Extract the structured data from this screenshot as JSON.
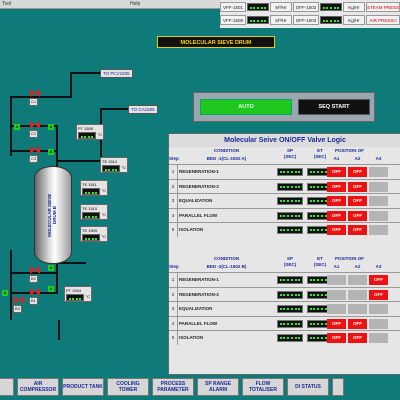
{
  "topbar": {
    "left_label": "Tool",
    "right_label": "Help"
  },
  "header": {
    "rows": [
      {
        "tag1": "VFF-1501",
        "unit1": "M³/Hr",
        "tag2": "OFF-1502",
        "unit2": "Kg/Hr",
        "status": "STEAM PRESS"
      },
      {
        "tag1": "VFF-1505",
        "unit1": "M³/Hr",
        "tag2": "OFF-1503",
        "unit2": "Kg/Hr",
        "status": "AIR PRESSU"
      }
    ]
  },
  "drum_title": "MOLECULAR SIEVE DRUM",
  "vessel": {
    "label": "MOLECULAR SIEVE DRUM B",
    "tag": "CL-1502B"
  },
  "destinations": {
    "d1": "TO PCV1505",
    "d2": "TO CA1506"
  },
  "instruments": [
    {
      "tag": "PT 1505",
      "unit": "°C"
    },
    {
      "tag": "TE 1514",
      "unit": "°C"
    },
    {
      "tag": "TE 1511",
      "unit": "°C"
    },
    {
      "tag": "TE 1510",
      "unit": "°C"
    },
    {
      "tag": "TE 1509",
      "unit": "°C"
    },
    {
      "tag": "PT 1504",
      "unit": "°C"
    }
  ],
  "valves": {
    "c1": "C1",
    "c2": "C2",
    "c3": "C3",
    "b1": "B1",
    "b2": "B2",
    "b3": "B3"
  },
  "controls": {
    "auto": "AUTO",
    "seq_start": "SEQ START"
  },
  "table": {
    "title": "Molecular Seive ON/OFF Valve Logic",
    "h_step": "Step",
    "h_condition": "CONDITION",
    "h_sp": "SP",
    "h_sp_unit": "(SEC)",
    "h_et": "ET",
    "h_et_unit": "(SEC)",
    "h_position": "POSITION OF",
    "pos_cols": [
      "A1",
      "A2",
      "A3"
    ],
    "bed1": {
      "name": "BED -1(CL-1502 A)",
      "rows": [
        {
          "step": "1",
          "cond": "REGENERATION-1",
          "pos": [
            "OFF",
            "OFF",
            ""
          ]
        },
        {
          "step": "2",
          "cond": "REGENERATION-2",
          "pos": [
            "OFF",
            "OFF",
            ""
          ]
        },
        {
          "step": "3",
          "cond": "EQUALIZATION",
          "pos": [
            "OFF",
            "OFF",
            ""
          ]
        },
        {
          "step": "4",
          "cond": "PARALLEL FLOW",
          "pos": [
            "OFF",
            "OFF",
            ""
          ]
        },
        {
          "step": "5",
          "cond": "ISOLATION",
          "pos": [
            "OFF",
            "OFF",
            ""
          ]
        }
      ]
    },
    "bed2": {
      "name": "BED -2(CL-1502 B)",
      "rows": [
        {
          "step": "1",
          "cond": "REGENERATION-1",
          "pos": [
            "",
            "",
            "OFF"
          ]
        },
        {
          "step": "2",
          "cond": "REGENERATION-2",
          "pos": [
            "",
            "",
            "OFF"
          ]
        },
        {
          "step": "3",
          "cond": "EQUALIZATION",
          "pos": [
            "",
            "",
            ""
          ]
        },
        {
          "step": "4",
          "cond": "PARALLEL FLOW",
          "pos": [
            "OFF",
            "OFF",
            ""
          ]
        },
        {
          "step": "5",
          "cond": "ISOLATION",
          "pos": [
            "OFF",
            "OFF",
            ""
          ]
        }
      ]
    }
  },
  "nav": [
    "",
    "AIR COMPRESSOR",
    "PRODUCT TANK",
    "COOLING TOWER",
    "PROCESS PARAMETER",
    "SP RANGE ALARM",
    "FLOW TOTALISER",
    "DI STATUS",
    ""
  ],
  "colors": {
    "background": "#0f7a7a",
    "off": "#ee1111",
    "auto": "#1ec81e",
    "title_text": "#1a2a9a"
  }
}
